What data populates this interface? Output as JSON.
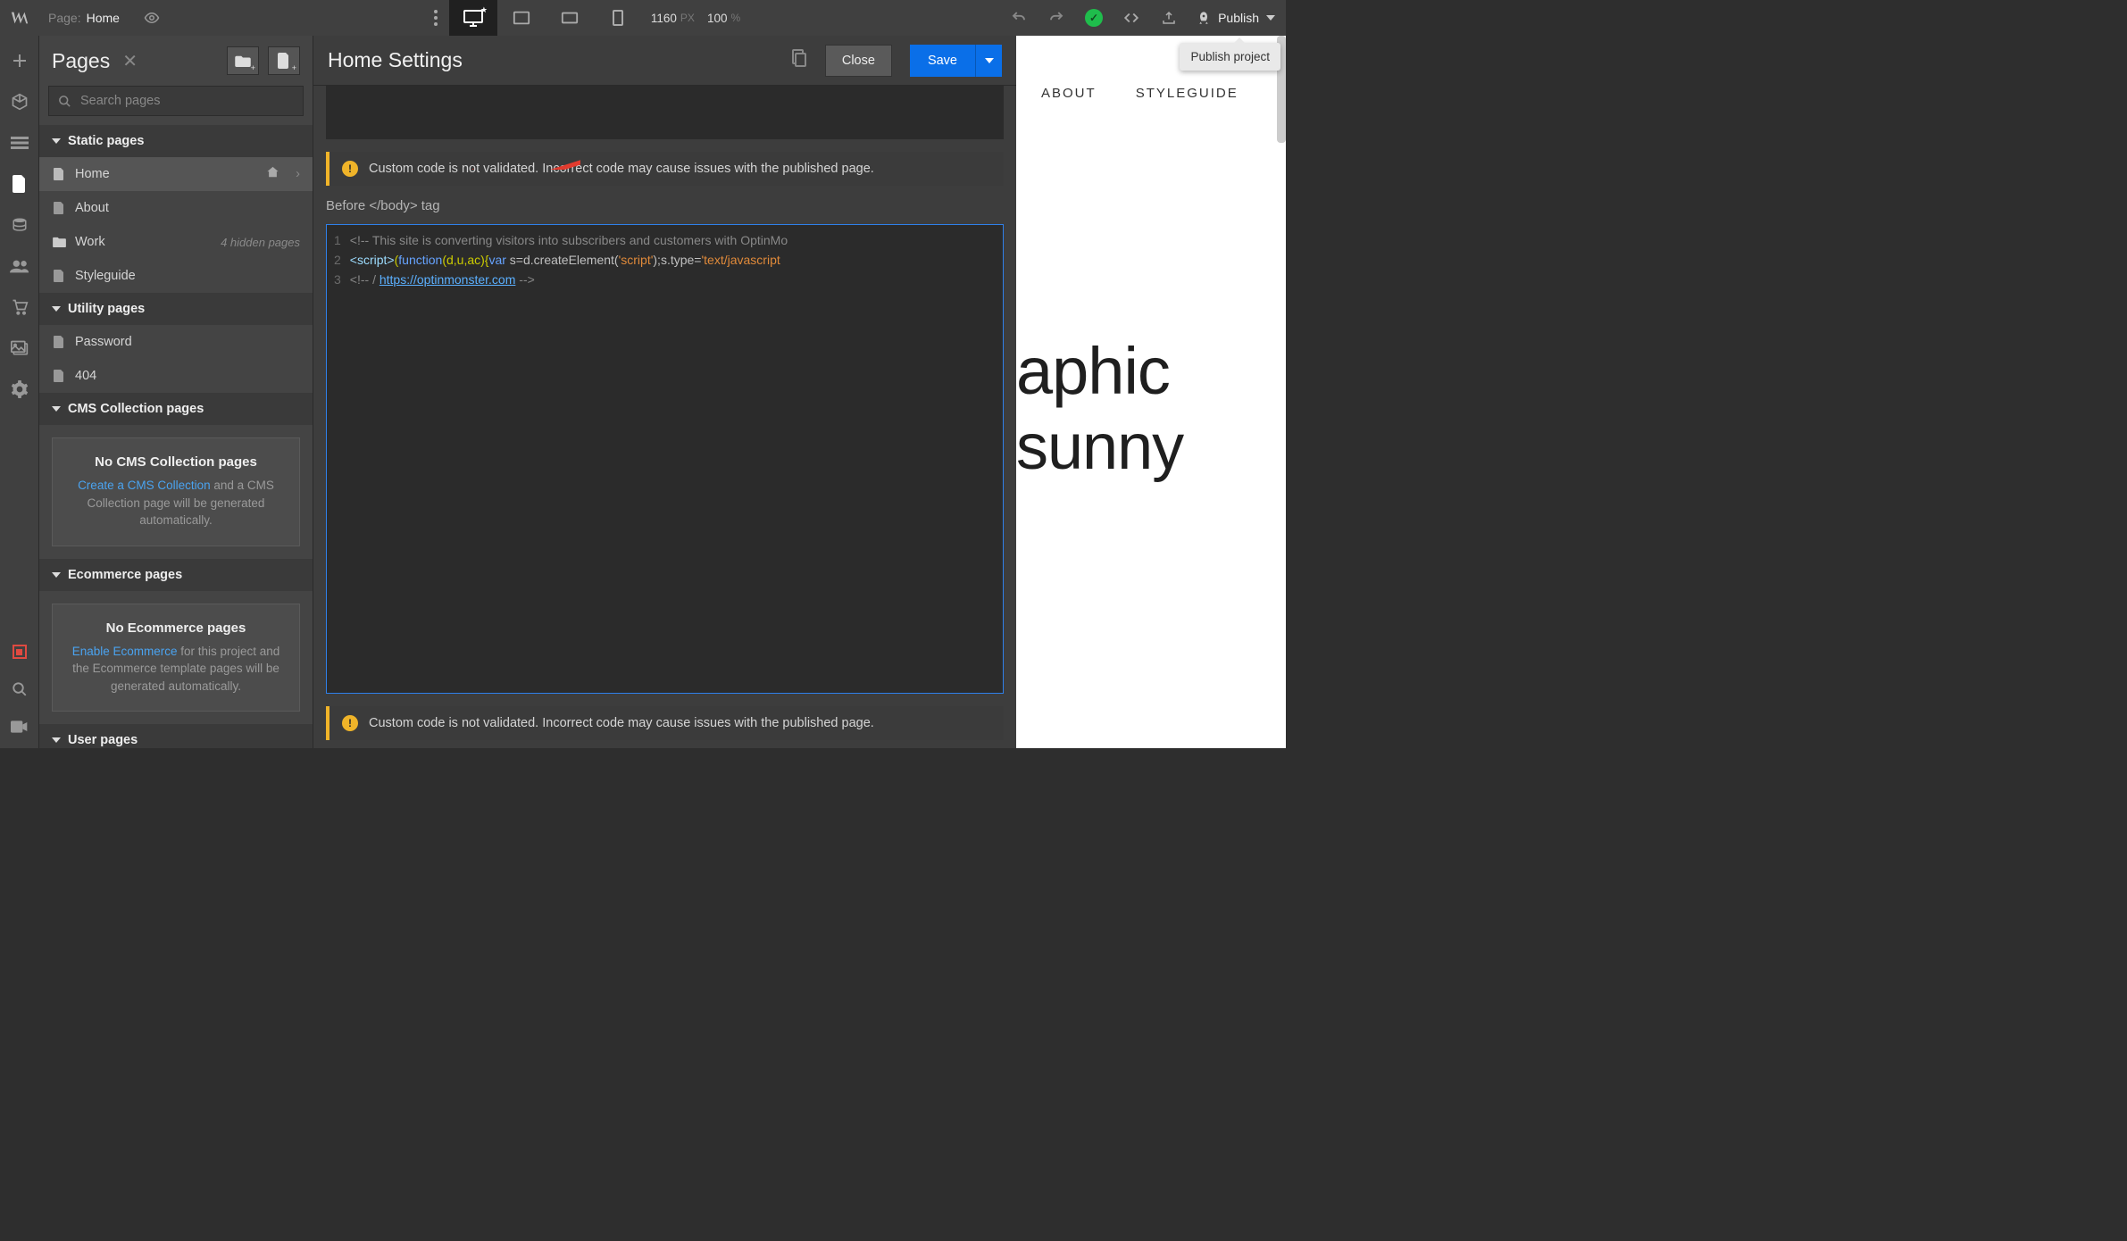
{
  "topbar": {
    "page_label": "Page:",
    "page_name": "Home",
    "width_value": "1160",
    "width_unit": "PX",
    "zoom_value": "100",
    "zoom_unit": "%",
    "publish_label": "Publish",
    "tooltip_publish": "Publish project"
  },
  "pages_panel": {
    "title": "Pages",
    "search_placeholder": "Search pages",
    "sections": {
      "static": "Static pages",
      "utility": "Utility pages",
      "cms": "CMS Collection pages",
      "ecom": "Ecommerce pages",
      "user": "User pages"
    },
    "static_items": {
      "home": "Home",
      "about": "About",
      "work": "Work",
      "work_badge": "4 hidden pages",
      "styleguide": "Styleguide"
    },
    "utility_items": {
      "password": "Password",
      "notfound": "404"
    },
    "cms_empty": {
      "title": "No CMS Collection pages",
      "link": "Create a CMS Collection",
      "rest": " and a CMS Collection page will be generated automatically."
    },
    "ecom_empty": {
      "title": "No Ecommerce pages",
      "link": "Enable Ecommerce",
      "rest": " for this project and the Ecommerce template pages will be generated automatically."
    }
  },
  "settings": {
    "title": "Home Settings",
    "close_label": "Close",
    "save_label": "Save",
    "warning_text": "Custom code is not validated. Incorrect code may cause issues with the published page.",
    "code_section_label": "Before </body> tag",
    "code_lines": {
      "l1_a": "<!-- ",
      "l1_b": "This site is converting visitors into subscribers and customers with OptinMo",
      "l2_tag_open": "<script>",
      "l2_p1": "(",
      "l2_kw": "function",
      "l2_args": "(d,u,ac){",
      "l2_var": "var",
      "l2_mid": " s=d.createElement(",
      "l2_str1": "'script'",
      "l2_mid2": ");s.type=",
      "l2_str2": "'text/javascript",
      "l3_a": "<!-- / ",
      "l3_url": "https://optinmonster.com",
      "l3_b": " -->"
    }
  },
  "canvas": {
    "nav": {
      "about": "ABOUT",
      "styleguide": "STYLEGUIDE"
    },
    "hero_line1": "aphic",
    "hero_line2": "sunny"
  }
}
